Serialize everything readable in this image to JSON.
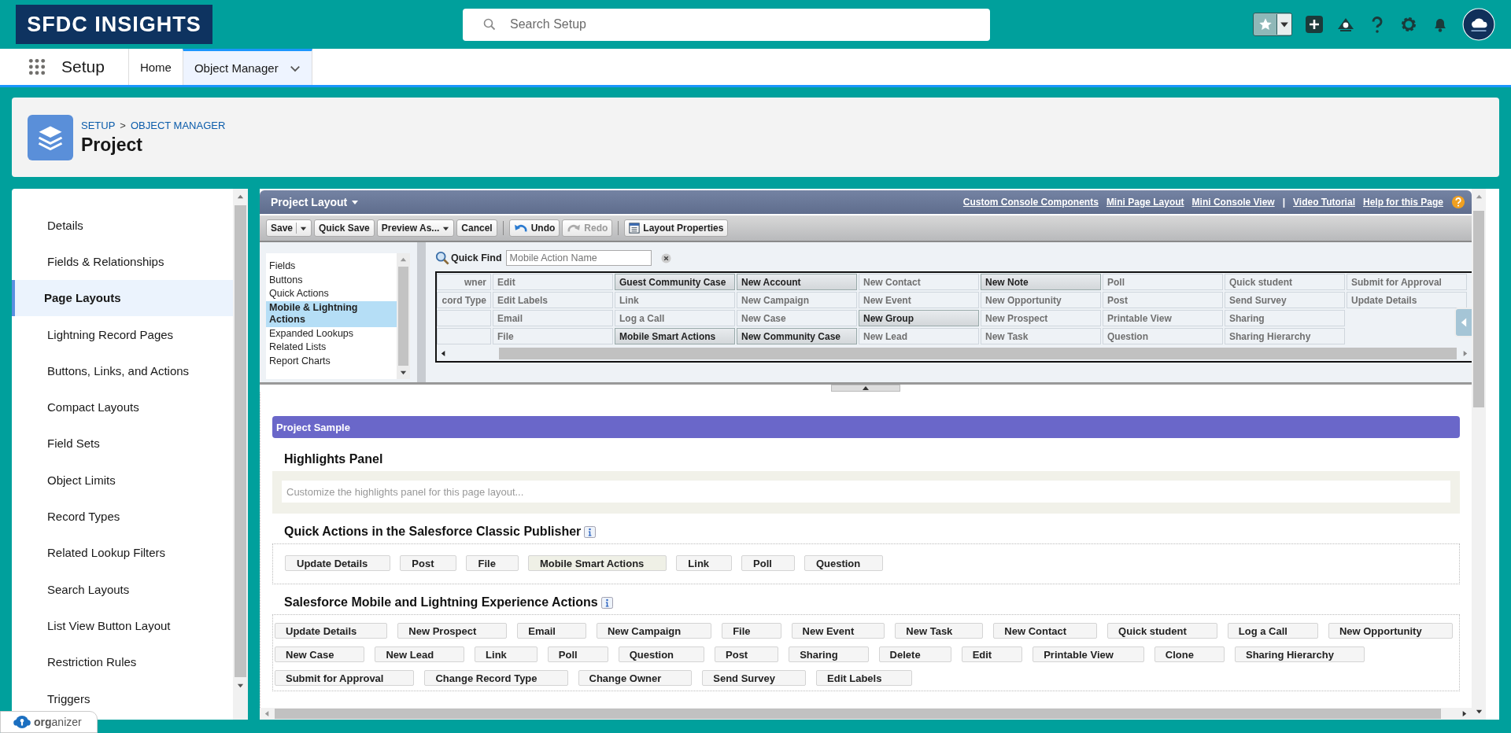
{
  "brand": {
    "logo": "SFDC INSIGHTS"
  },
  "search": {
    "placeholder": "Search Setup"
  },
  "app_nav": {
    "app_name": "Setup",
    "tabs": [
      {
        "label": "Home",
        "selected": false
      },
      {
        "label": "Object Manager",
        "selected": true
      }
    ]
  },
  "header": {
    "breadcrumbs": [
      "SETUP",
      "OBJECT MANAGER"
    ],
    "separator": ">",
    "title": "Project"
  },
  "sidebar": {
    "items": [
      {
        "label": "Details",
        "selected": false
      },
      {
        "label": "Fields & Relationships",
        "selected": false
      },
      {
        "label": "Page Layouts",
        "selected": true
      },
      {
        "label": "Lightning Record Pages",
        "selected": false
      },
      {
        "label": "Buttons, Links, and Actions",
        "selected": false
      },
      {
        "label": "Compact Layouts",
        "selected": false
      },
      {
        "label": "Field Sets",
        "selected": false
      },
      {
        "label": "Object Limits",
        "selected": false
      },
      {
        "label": "Record Types",
        "selected": false
      },
      {
        "label": "Related Lookup Filters",
        "selected": false
      },
      {
        "label": "Search Layouts",
        "selected": false
      },
      {
        "label": "List View Button Layout",
        "selected": false
      },
      {
        "label": "Restriction Rules",
        "selected": false
      },
      {
        "label": "Triggers",
        "selected": false
      }
    ]
  },
  "layout_editor": {
    "title": "Project Layout",
    "links": [
      {
        "label": "Custom Console Components",
        "kind": "link"
      },
      {
        "label": "Mini Page Layout",
        "kind": "link"
      },
      {
        "label": "Mini Console View",
        "kind": "link"
      },
      {
        "label": "|",
        "kind": "separator"
      },
      {
        "label": "Video Tutorial",
        "kind": "link"
      },
      {
        "label": "Help for this Page",
        "kind": "link"
      }
    ],
    "toolbar": [
      [
        {
          "label": "Save",
          "kind": "split",
          "disabled": false
        },
        {
          "label": "Quick Save",
          "kind": "plain",
          "disabled": false
        },
        {
          "label": "Preview As...",
          "kind": "dropdown",
          "disabled": false
        },
        {
          "label": "Cancel",
          "kind": "plain",
          "disabled": false
        }
      ],
      [
        {
          "label": "Undo",
          "kind": "undo",
          "disabled": false
        },
        {
          "label": "Redo",
          "kind": "redo",
          "disabled": true
        }
      ],
      [
        {
          "label": "Layout Properties",
          "kind": "properties",
          "disabled": false
        }
      ]
    ],
    "categories": [
      {
        "label": "Fields",
        "selected": false
      },
      {
        "label": "Buttons",
        "selected": false
      },
      {
        "label": "Quick Actions",
        "selected": false
      },
      {
        "label": "Mobile & Lightning Actions",
        "selected": true
      },
      {
        "label": "Expanded Lookups",
        "selected": false
      },
      {
        "label": "Related Lists",
        "selected": false
      },
      {
        "label": "Report Charts",
        "selected": false
      }
    ],
    "quick_find": {
      "label": "Quick Find",
      "placeholder": "Mobile Action Name"
    },
    "palette_columns": [
      [
        {
          "label": "wner",
          "shaded": false
        },
        {
          "label": "cord Type",
          "shaded": false
        }
      ],
      [
        {
          "label": "Edit",
          "shaded": false
        },
        {
          "label": "Edit Labels",
          "shaded": false
        },
        {
          "label": "Email",
          "shaded": false
        },
        {
          "label": "File",
          "shaded": false
        }
      ],
      [
        {
          "label": "Guest Community Case",
          "shaded": true
        },
        {
          "label": "Link",
          "shaded": false
        },
        {
          "label": "Log a Call",
          "shaded": false
        },
        {
          "label": "Mobile Smart Actions",
          "shaded": true
        }
      ],
      [
        {
          "label": "New Account",
          "shaded": true
        },
        {
          "label": "New Campaign",
          "shaded": false
        },
        {
          "label": "New Case",
          "shaded": false
        },
        {
          "label": "New Community Case",
          "shaded": true
        }
      ],
      [
        {
          "label": "New Contact",
          "shaded": false
        },
        {
          "label": "New Event",
          "shaded": false
        },
        {
          "label": "New Group",
          "shaded": true
        },
        {
          "label": "New Lead",
          "shaded": false
        }
      ],
      [
        {
          "label": "New Note",
          "shaded": true
        },
        {
          "label": "New Opportunity",
          "shaded": false
        },
        {
          "label": "New Prospect",
          "shaded": false
        },
        {
          "label": "New Task",
          "shaded": false
        }
      ],
      [
        {
          "label": "Poll",
          "shaded": false
        },
        {
          "label": "Post",
          "shaded": false
        },
        {
          "label": "Printable View",
          "shaded": false
        },
        {
          "label": "Question",
          "shaded": false
        }
      ],
      [
        {
          "label": "Quick student",
          "shaded": false
        },
        {
          "label": "Send Survey",
          "shaded": false
        },
        {
          "label": "Sharing",
          "shaded": false
        },
        {
          "label": "Sharing Hierarchy",
          "shaded": false
        }
      ],
      [
        {
          "label": "Submit for Approval",
          "shaded": false
        },
        {
          "label": "Update Details",
          "shaded": false
        }
      ]
    ],
    "canvas": {
      "section_title": "Project Sample",
      "highlights": {
        "title": "Highlights Panel",
        "placeholder": "Customize the highlights panel for this page layout..."
      },
      "classic": {
        "title": "Quick Actions in the Salesforce Classic Publisher",
        "actions": [
          {
            "label": "Update Details",
            "highlighted": false
          },
          {
            "label": "Post",
            "highlighted": false
          },
          {
            "label": "File",
            "highlighted": false
          },
          {
            "label": "Mobile Smart Actions",
            "highlighted": true
          },
          {
            "label": "Link",
            "highlighted": false
          },
          {
            "label": "Poll",
            "highlighted": false
          },
          {
            "label": "Question",
            "highlighted": false
          }
        ]
      },
      "mobile": {
        "title": "Salesforce Mobile and Lightning Experience Actions",
        "actions": [
          "Update Details",
          "New Prospect",
          "Email",
          "New Campaign",
          "File",
          "New Event",
          "New Task",
          "New Contact",
          "Quick student",
          "Log a Call",
          "New Opportunity",
          "New Case",
          "New Lead",
          "Link",
          "Poll",
          "Question",
          "Post",
          "Sharing",
          "Delete",
          "Edit",
          "Printable View",
          "Clone",
          "Sharing Hierarchy",
          "Submit for Approval",
          "Change Record Type",
          "Change Owner",
          "Send Survey",
          "Edit Labels"
        ]
      }
    }
  },
  "organizer": {
    "label": "**org**anizer"
  }
}
